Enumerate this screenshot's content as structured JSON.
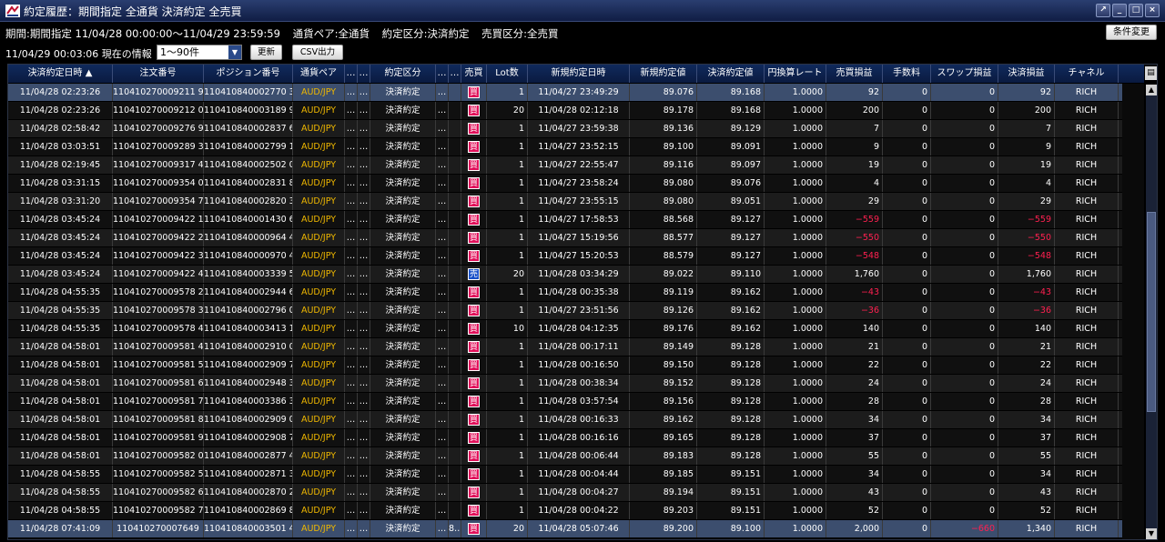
{
  "window": {
    "title": "約定履歴：期間指定 全通貨 決済約定 全売買",
    "buttons": {
      "pin": "↗",
      "minimize": "_",
      "maximize": "□",
      "close": "×"
    }
  },
  "filters": {
    "period": "期間:期間指定 11/04/28 00:00:00～11/04/29 23:59:59",
    "pair": "通貨ペア:全通貨",
    "trade_type": "約定区分:決済約定",
    "side": "売買区分:全売買",
    "change_button": "条件変更"
  },
  "info": {
    "timestamp": "11/04/29 00:03:06 現在の情報",
    "count_select": "1～90件",
    "refresh_button": "更新",
    "csv_button": "CSV出力"
  },
  "columns": [
    "決済約定日時 ▲",
    "注文番号",
    "ポジション番号",
    "通貨ペア",
    "…",
    "…",
    "約定区分",
    "…",
    "…",
    "売買",
    "Lot数",
    "新規約定日時",
    "新規約定値",
    "決済約定値",
    "円換算レート",
    "売買損益",
    "手数料",
    "スワップ損益",
    "決済損益",
    "チャネル"
  ],
  "colors": {
    "buy": "#e0105a",
    "sell": "#1850c8",
    "gold": "#f0b800",
    "negative": "#ff2050"
  },
  "rows": [
    {
      "dt": "11/04/28 02:23:26",
      "order": "110410270009211 9",
      "pos": "110410840002770 3",
      "pair": "AUD/JPY",
      "e1": "…",
      "e2": "…",
      "type": "決済約定",
      "e3": "…",
      "e4": "",
      "side": "買",
      "lot": "1",
      "open_dt": "11/04/27 23:49:29",
      "open_price": "89.076",
      "close_price": "89.168",
      "rate": "1.0000",
      "pl": "92",
      "fee": "0",
      "swap": "0",
      "net": "92",
      "channel": "RICH",
      "pl_neg": false,
      "swap_neg": false,
      "net_neg": false,
      "selected": true
    },
    {
      "dt": "11/04/28 02:23:26",
      "order": "110410270009212 0",
      "pos": "110410840003189 9",
      "pair": "AUD/JPY",
      "e1": "…",
      "e2": "…",
      "type": "決済約定",
      "e3": "…",
      "e4": "",
      "side": "買",
      "lot": "20",
      "open_dt": "11/04/28 02:12:18",
      "open_price": "89.178",
      "close_price": "89.168",
      "rate": "1.0000",
      "pl": "200",
      "fee": "0",
      "swap": "0",
      "net": "200",
      "channel": "RICH"
    },
    {
      "dt": "11/04/28 02:58:42",
      "order": "110410270009276 9",
      "pos": "110410840002837 6",
      "pair": "AUD/JPY",
      "e1": "…",
      "e2": "…",
      "type": "決済約定",
      "e3": "…",
      "e4": "",
      "side": "買",
      "lot": "1",
      "open_dt": "11/04/27 23:59:38",
      "open_price": "89.136",
      "close_price": "89.129",
      "rate": "1.0000",
      "pl": "7",
      "fee": "0",
      "swap": "0",
      "net": "7",
      "channel": "RICH"
    },
    {
      "dt": "11/04/28 03:03:51",
      "order": "110410270009289 3",
      "pos": "110410840002799 1",
      "pair": "AUD/JPY",
      "e1": "…",
      "e2": "…",
      "type": "決済約定",
      "e3": "…",
      "e4": "",
      "side": "買",
      "lot": "1",
      "open_dt": "11/04/27 23:52:15",
      "open_price": "89.100",
      "close_price": "89.091",
      "rate": "1.0000",
      "pl": "9",
      "fee": "0",
      "swap": "0",
      "net": "9",
      "channel": "RICH"
    },
    {
      "dt": "11/04/28 02:19:45",
      "order": "110410270009317 4",
      "pos": "110410840002502 0",
      "pair": "AUD/JPY",
      "e1": "…",
      "e2": "…",
      "type": "決済約定",
      "e3": "…",
      "e4": "",
      "side": "買",
      "lot": "1",
      "open_dt": "11/04/27 22:55:47",
      "open_price": "89.116",
      "close_price": "89.097",
      "rate": "1.0000",
      "pl": "19",
      "fee": "0",
      "swap": "0",
      "net": "19",
      "channel": "RICH"
    },
    {
      "dt": "11/04/28 03:31:15",
      "order": "110410270009354 0",
      "pos": "110410840002831 8",
      "pair": "AUD/JPY",
      "e1": "…",
      "e2": "…",
      "type": "決済約定",
      "e3": "…",
      "e4": "",
      "side": "買",
      "lot": "1",
      "open_dt": "11/04/27 23:58:24",
      "open_price": "89.080",
      "close_price": "89.076",
      "rate": "1.0000",
      "pl": "4",
      "fee": "0",
      "swap": "0",
      "net": "4",
      "channel": "RICH"
    },
    {
      "dt": "11/04/28 03:31:20",
      "order": "110410270009354 7",
      "pos": "110410840002820 3",
      "pair": "AUD/JPY",
      "e1": "…",
      "e2": "…",
      "type": "決済約定",
      "e3": "…",
      "e4": "",
      "side": "買",
      "lot": "1",
      "open_dt": "11/04/27 23:55:15",
      "open_price": "89.080",
      "close_price": "89.051",
      "rate": "1.0000",
      "pl": "29",
      "fee": "0",
      "swap": "0",
      "net": "29",
      "channel": "RICH"
    },
    {
      "dt": "11/04/28 03:45:24",
      "order": "110410270009422 1",
      "pos": "110410840001430 6",
      "pair": "AUD/JPY",
      "e1": "…",
      "e2": "…",
      "type": "決済約定",
      "e3": "…",
      "e4": "",
      "side": "買",
      "lot": "1",
      "open_dt": "11/04/27 17:58:53",
      "open_price": "88.568",
      "close_price": "89.127",
      "rate": "1.0000",
      "pl": "−559",
      "fee": "0",
      "swap": "0",
      "net": "−559",
      "channel": "RICH",
      "pl_neg": true,
      "net_neg": true
    },
    {
      "dt": "11/04/28 03:45:24",
      "order": "110410270009422 2",
      "pos": "110410840000964 4",
      "pair": "AUD/JPY",
      "e1": "…",
      "e2": "…",
      "type": "決済約定",
      "e3": "…",
      "e4": "",
      "side": "買",
      "lot": "1",
      "open_dt": "11/04/27 15:19:56",
      "open_price": "88.577",
      "close_price": "89.127",
      "rate": "1.0000",
      "pl": "−550",
      "fee": "0",
      "swap": "0",
      "net": "−550",
      "channel": "RICH",
      "pl_neg": true,
      "net_neg": true
    },
    {
      "dt": "11/04/28 03:45:24",
      "order": "110410270009422 3",
      "pos": "110410840000970 4",
      "pair": "AUD/JPY",
      "e1": "…",
      "e2": "…",
      "type": "決済約定",
      "e3": "…",
      "e4": "",
      "side": "買",
      "lot": "1",
      "open_dt": "11/04/27 15:20:53",
      "open_price": "88.579",
      "close_price": "89.127",
      "rate": "1.0000",
      "pl": "−548",
      "fee": "0",
      "swap": "0",
      "net": "−548",
      "channel": "RICH",
      "pl_neg": true,
      "net_neg": true
    },
    {
      "dt": "11/04/28 03:45:24",
      "order": "110410270009422 4",
      "pos": "110410840003339 5",
      "pair": "AUD/JPY",
      "e1": "…",
      "e2": "…",
      "type": "決済約定",
      "e3": "…",
      "e4": "",
      "side": "売",
      "lot": "20",
      "open_dt": "11/04/28 03:34:29",
      "open_price": "89.022",
      "close_price": "89.110",
      "rate": "1.0000",
      "pl": "1,760",
      "fee": "0",
      "swap": "0",
      "net": "1,760",
      "channel": "RICH"
    },
    {
      "dt": "11/04/28 04:55:35",
      "order": "110410270009578 2",
      "pos": "110410840002944 6",
      "pair": "AUD/JPY",
      "e1": "…",
      "e2": "…",
      "type": "決済約定",
      "e3": "…",
      "e4": "",
      "side": "買",
      "lot": "1",
      "open_dt": "11/04/28 00:35:38",
      "open_price": "89.119",
      "close_price": "89.162",
      "rate": "1.0000",
      "pl": "−43",
      "fee": "0",
      "swap": "0",
      "net": "−43",
      "channel": "RICH",
      "pl_neg": true,
      "net_neg": true
    },
    {
      "dt": "11/04/28 04:55:35",
      "order": "110410270009578 3",
      "pos": "110410840002796 0",
      "pair": "AUD/JPY",
      "e1": "…",
      "e2": "…",
      "type": "決済約定",
      "e3": "…",
      "e4": "",
      "side": "買",
      "lot": "1",
      "open_dt": "11/04/27 23:51:56",
      "open_price": "89.126",
      "close_price": "89.162",
      "rate": "1.0000",
      "pl": "−36",
      "fee": "0",
      "swap": "0",
      "net": "−36",
      "channel": "RICH",
      "pl_neg": true,
      "net_neg": true
    },
    {
      "dt": "11/04/28 04:55:35",
      "order": "110410270009578 4",
      "pos": "110410840003413 1",
      "pair": "AUD/JPY",
      "e1": "…",
      "e2": "…",
      "type": "決済約定",
      "e3": "…",
      "e4": "",
      "side": "買",
      "lot": "10",
      "open_dt": "11/04/28 04:12:35",
      "open_price": "89.176",
      "close_price": "89.162",
      "rate": "1.0000",
      "pl": "140",
      "fee": "0",
      "swap": "0",
      "net": "140",
      "channel": "RICH"
    },
    {
      "dt": "11/04/28 04:58:01",
      "order": "110410270009581 4",
      "pos": "110410840002910 0",
      "pair": "AUD/JPY",
      "e1": "…",
      "e2": "…",
      "type": "決済約定",
      "e3": "…",
      "e4": "",
      "side": "買",
      "lot": "1",
      "open_dt": "11/04/28 00:17:11",
      "open_price": "89.149",
      "close_price": "89.128",
      "rate": "1.0000",
      "pl": "21",
      "fee": "0",
      "swap": "0",
      "net": "21",
      "channel": "RICH"
    },
    {
      "dt": "11/04/28 04:58:01",
      "order": "110410270009581 5",
      "pos": "110410840002909 7",
      "pair": "AUD/JPY",
      "e1": "…",
      "e2": "…",
      "type": "決済約定",
      "e3": "…",
      "e4": "",
      "side": "買",
      "lot": "1",
      "open_dt": "11/04/28 00:16:50",
      "open_price": "89.150",
      "close_price": "89.128",
      "rate": "1.0000",
      "pl": "22",
      "fee": "0",
      "swap": "0",
      "net": "22",
      "channel": "RICH"
    },
    {
      "dt": "11/04/28 04:58:01",
      "order": "110410270009581 6",
      "pos": "110410840002948 3",
      "pair": "AUD/JPY",
      "e1": "…",
      "e2": "…",
      "type": "決済約定",
      "e3": "…",
      "e4": "",
      "side": "買",
      "lot": "1",
      "open_dt": "11/04/28 00:38:34",
      "open_price": "89.152",
      "close_price": "89.128",
      "rate": "1.0000",
      "pl": "24",
      "fee": "0",
      "swap": "0",
      "net": "24",
      "channel": "RICH"
    },
    {
      "dt": "11/04/28 04:58:01",
      "order": "110410270009581 7",
      "pos": "110410840003386 3",
      "pair": "AUD/JPY",
      "e1": "…",
      "e2": "…",
      "type": "決済約定",
      "e3": "…",
      "e4": "",
      "side": "買",
      "lot": "1",
      "open_dt": "11/04/28 03:57:54",
      "open_price": "89.156",
      "close_price": "89.128",
      "rate": "1.0000",
      "pl": "28",
      "fee": "0",
      "swap": "0",
      "net": "28",
      "channel": "RICH"
    },
    {
      "dt": "11/04/28 04:58:01",
      "order": "110410270009581 8",
      "pos": "110410840002909 0",
      "pair": "AUD/JPY",
      "e1": "…",
      "e2": "…",
      "type": "決済約定",
      "e3": "…",
      "e4": "",
      "side": "買",
      "lot": "1",
      "open_dt": "11/04/28 00:16:33",
      "open_price": "89.162",
      "close_price": "89.128",
      "rate": "1.0000",
      "pl": "34",
      "fee": "0",
      "swap": "0",
      "net": "34",
      "channel": "RICH"
    },
    {
      "dt": "11/04/28 04:58:01",
      "order": "110410270009581 9",
      "pos": "110410840002908 7",
      "pair": "AUD/JPY",
      "e1": "…",
      "e2": "…",
      "type": "決済約定",
      "e3": "…",
      "e4": "",
      "side": "買",
      "lot": "1",
      "open_dt": "11/04/28 00:16:16",
      "open_price": "89.165",
      "close_price": "89.128",
      "rate": "1.0000",
      "pl": "37",
      "fee": "0",
      "swap": "0",
      "net": "37",
      "channel": "RICH"
    },
    {
      "dt": "11/04/28 04:58:01",
      "order": "110410270009582 0",
      "pos": "110410840002877 4",
      "pair": "AUD/JPY",
      "e1": "…",
      "e2": "…",
      "type": "決済約定",
      "e3": "…",
      "e4": "",
      "side": "買",
      "lot": "1",
      "open_dt": "11/04/28 00:06:44",
      "open_price": "89.183",
      "close_price": "89.128",
      "rate": "1.0000",
      "pl": "55",
      "fee": "0",
      "swap": "0",
      "net": "55",
      "channel": "RICH"
    },
    {
      "dt": "11/04/28 04:58:55",
      "order": "110410270009582 5",
      "pos": "110410840002871 3",
      "pair": "AUD/JPY",
      "e1": "…",
      "e2": "…",
      "type": "決済約定",
      "e3": "…",
      "e4": "",
      "side": "買",
      "lot": "1",
      "open_dt": "11/04/28 00:04:44",
      "open_price": "89.185",
      "close_price": "89.151",
      "rate": "1.0000",
      "pl": "34",
      "fee": "0",
      "swap": "0",
      "net": "34",
      "channel": "RICH"
    },
    {
      "dt": "11/04/28 04:58:55",
      "order": "110410270009582 6",
      "pos": "110410840002870 2",
      "pair": "AUD/JPY",
      "e1": "…",
      "e2": "…",
      "type": "決済約定",
      "e3": "…",
      "e4": "",
      "side": "買",
      "lot": "1",
      "open_dt": "11/04/28 00:04:27",
      "open_price": "89.194",
      "close_price": "89.151",
      "rate": "1.0000",
      "pl": "43",
      "fee": "0",
      "swap": "0",
      "net": "43",
      "channel": "RICH"
    },
    {
      "dt": "11/04/28 04:58:55",
      "order": "110410270009582 7",
      "pos": "110410840002869 8",
      "pair": "AUD/JPY",
      "e1": "…",
      "e2": "…",
      "type": "決済約定",
      "e3": "…",
      "e4": "",
      "side": "買",
      "lot": "1",
      "open_dt": "11/04/28 00:04:22",
      "open_price": "89.203",
      "close_price": "89.151",
      "rate": "1.0000",
      "pl": "52",
      "fee": "0",
      "swap": "0",
      "net": "52",
      "channel": "RICH"
    },
    {
      "dt": "11/04/28 07:41:09",
      "order": "110410270007649",
      "pos": "110410840003501 4",
      "pair": "AUD/JPY",
      "e1": "…",
      "e2": "…",
      "type": "決済約定",
      "e3": "…",
      "e4": "8…",
      "side": "買",
      "lot": "20",
      "open_dt": "11/04/28 05:07:46",
      "open_price": "89.200",
      "close_price": "89.100",
      "rate": "1.0000",
      "pl": "2,000",
      "fee": "0",
      "swap": "−660",
      "net": "1,340",
      "channel": "RICH",
      "swap_neg": true,
      "selected": true
    }
  ]
}
